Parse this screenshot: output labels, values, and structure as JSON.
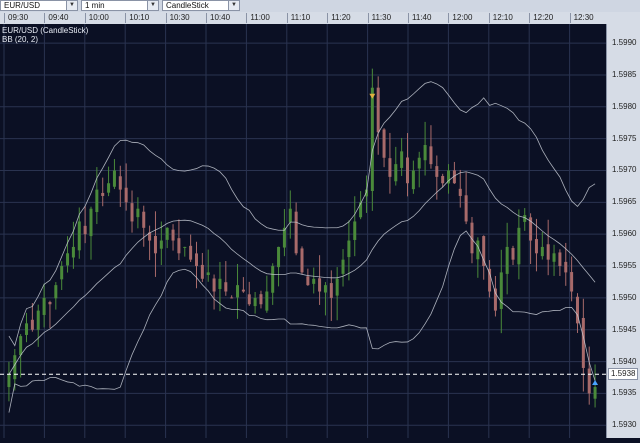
{
  "toolbar": {
    "symbol": "EUR/USD",
    "interval": "1 min",
    "chart_style": "CandleStick"
  },
  "chart_header": {
    "series_label": "EUR/USD (CandleStick)",
    "indicator_label": "BB (20, 2)"
  },
  "colors": {
    "background": "#0b1024",
    "grid": "#2a3350",
    "candle_up": "#4a8a3a",
    "candle_down": "#a86a6a",
    "bands": "#c8ccd6",
    "price_line": "#ffffff",
    "marker_buy": "#4aa3ff",
    "marker_sell": "#e0b040"
  },
  "chart_data": {
    "type": "candlestick",
    "x_tick_labels": [
      "09:30",
      "09:40",
      "10:00",
      "10:10",
      "10:30",
      "10:40",
      "11:00",
      "11:10",
      "11:20",
      "11:30",
      "11:40",
      "12:00",
      "12:10",
      "12:20",
      "12:30"
    ],
    "y_tick_labels": [
      "1.5990",
      "1.5985",
      "1.5980",
      "1.5975",
      "1.5970",
      "1.5965",
      "1.5960",
      "1.5955",
      "1.5950",
      "1.5945",
      "1.5940",
      "1.5935",
      "1.5930"
    ],
    "current_price_label": "1.5938",
    "ylim": [
      1.5928,
      1.5993
    ],
    "grid": true,
    "close_series": [
      1.5938,
      1.5941,
      1.5944,
      1.5946,
      1.5945,
      1.5948,
      1.595,
      1.5949,
      1.5952,
      1.5955,
      1.5957,
      1.5958,
      1.5962,
      1.596,
      1.5964,
      1.5967,
      1.5966,
      1.5968,
      1.597,
      1.5967,
      1.5965,
      1.5962,
      1.5964,
      1.5961,
      1.5959,
      1.5957,
      1.5959,
      1.5961,
      1.5959,
      1.5957,
      1.5958,
      1.5956,
      1.5955,
      1.5953,
      1.5954,
      1.5951,
      1.5953,
      1.5951,
      1.595,
      1.5952,
      1.5951,
      1.5949,
      1.595,
      1.5949,
      1.5951,
      1.5955,
      1.5958,
      1.5961,
      1.5964,
      1.5957,
      1.5954,
      1.5952,
      1.5953,
      1.5951,
      1.5952,
      1.595,
      1.5953,
      1.5956,
      1.5959,
      1.5962,
      1.5965,
      1.5967,
      1.5983,
      1.5976,
      1.5972,
      1.5969,
      1.5971,
      1.5973,
      1.5968,
      1.597,
      1.5972,
      1.5974,
      1.5971,
      1.5969,
      1.5968,
      1.597,
      1.5968,
      1.5966,
      1.5962,
      1.5957,
      1.5959,
      1.5955,
      1.5951,
      1.5948,
      1.5954,
      1.5958,
      1.5956,
      1.5961,
      1.5963,
      1.5959,
      1.5957,
      1.5958,
      1.5956,
      1.5957,
      1.5955,
      1.5954,
      1.5951,
      1.5946,
      1.5939,
      1.5935,
      1.5936
    ],
    "markers": [
      {
        "type": "sell",
        "index": 62
      },
      {
        "type": "buy",
        "index": 100
      }
    ]
  }
}
